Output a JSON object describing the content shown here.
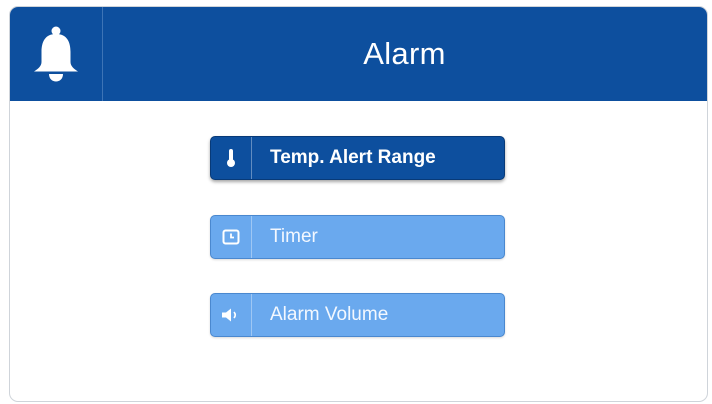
{
  "header": {
    "title": "Alarm",
    "icon": "bell-icon"
  },
  "menu": [
    {
      "label": "Temp. Alert Range",
      "icon": "thermometer-icon",
      "active": true
    },
    {
      "label": "Timer",
      "icon": "clock-icon",
      "active": false
    },
    {
      "label": "Alarm Volume",
      "icon": "speaker-icon",
      "active": false
    }
  ],
  "colors": {
    "header_bg": "#0d4f9e",
    "button_active": "#0d4f9e",
    "button_inactive": "#6aa9ee"
  }
}
